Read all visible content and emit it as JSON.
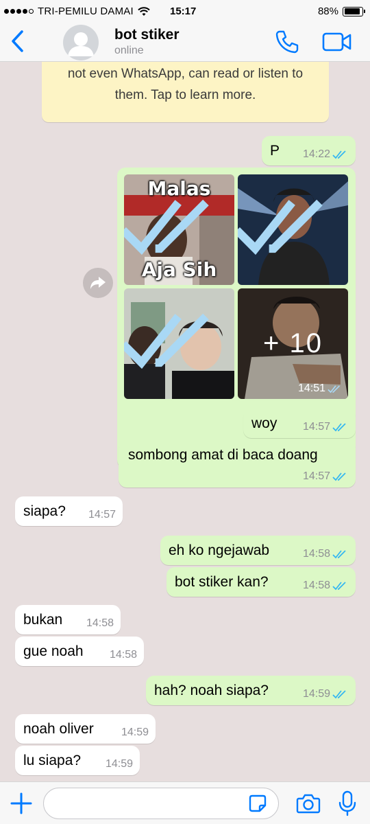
{
  "status_bar": {
    "carrier": "TRI-PEMILU DAMAI",
    "time": "15:17",
    "battery": "88%",
    "battery_level": 0.88
  },
  "header": {
    "name": "bot stiker",
    "status": "online",
    "back_icon": "chevron-left-icon",
    "call_icon": "phone-icon",
    "video_icon": "video-camera-icon"
  },
  "encryption_notice": {
    "line1": "not even WhatsApp, can read or listen to",
    "line2": "them. Tap to learn more."
  },
  "album": {
    "tile1_top": "Malas",
    "tile1_bottom": "Aja Sih",
    "more_count": "+ 10",
    "time": "14:51"
  },
  "messages": [
    {
      "direction": "out",
      "text": "P",
      "time": "14:22"
    },
    {
      "direction": "out",
      "text": "woy",
      "time": "14:57"
    },
    {
      "direction": "out",
      "text": "sombong amat di baca doang",
      "time": "14:57"
    },
    {
      "direction": "in",
      "text": "siapa?",
      "time": "14:57"
    },
    {
      "direction": "out",
      "text": "eh ko ngejawab",
      "time": "14:58"
    },
    {
      "direction": "out",
      "text": "bot stiker kan?",
      "time": "14:58"
    },
    {
      "direction": "in",
      "text": "bukan",
      "time": "14:58"
    },
    {
      "direction": "in",
      "text": "gue noah",
      "time": "14:58"
    },
    {
      "direction": "out",
      "text": "hah? noah siapa?",
      "time": "14:59"
    },
    {
      "direction": "in",
      "text": "noah oliver",
      "time": "14:59"
    },
    {
      "direction": "in",
      "text": "lu siapa?",
      "time": "14:59"
    }
  ],
  "input": {
    "value": "",
    "placeholder": ""
  },
  "colors": {
    "accent": "#007aff",
    "outgoing_bubble": "#dcf8c6",
    "incoming_bubble": "#ffffff",
    "read_ticks": "#34b7f1",
    "background": "#e7dede"
  }
}
